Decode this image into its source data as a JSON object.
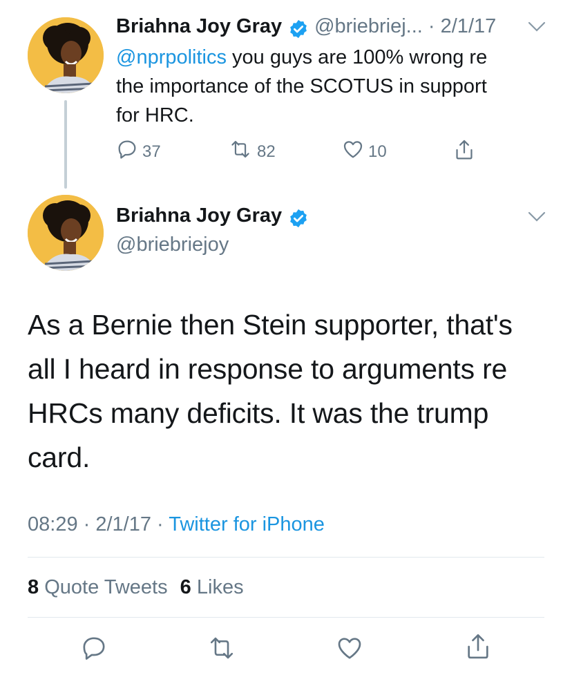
{
  "reply_tweet": {
    "author_name": "Briahna Joy Gray",
    "handle": "@briebriej...",
    "separator": " · ",
    "date": "2/1/17",
    "mention": "@nprpolitics",
    "text_line1": " you guys are 100% wrong re",
    "text_line2": "the importance of the SCOTUS in support",
    "text_line3": "for HRC.",
    "replies": "37",
    "retweets": "82",
    "likes": "10"
  },
  "main_tweet": {
    "author_name": "Briahna Joy Gray",
    "handle": "@briebriejoy",
    "text_line1": "As a Bernie then Stein supporter, that's",
    "text_line2": "all I heard in response to arguments re",
    "text_line3": "HRCs many deficits. It was the trump",
    "text_line4": "card.",
    "time": "08:29",
    "separator": " · ",
    "date": "2/1/17",
    "client": "Twitter for iPhone",
    "quote_count": "8",
    "quote_label": "Quote Tweets",
    "like_count": "6",
    "like_label": "Likes"
  },
  "icons": {
    "verified": "verified-badge-icon",
    "caret": "chevron-down-icon",
    "reply": "reply-icon",
    "retweet": "retweet-icon",
    "like": "heart-icon",
    "share": "share-icon"
  },
  "colors": {
    "link": "#1b95e0",
    "muted": "#657786",
    "text": "#14171a",
    "verified": "#1da1f2"
  }
}
